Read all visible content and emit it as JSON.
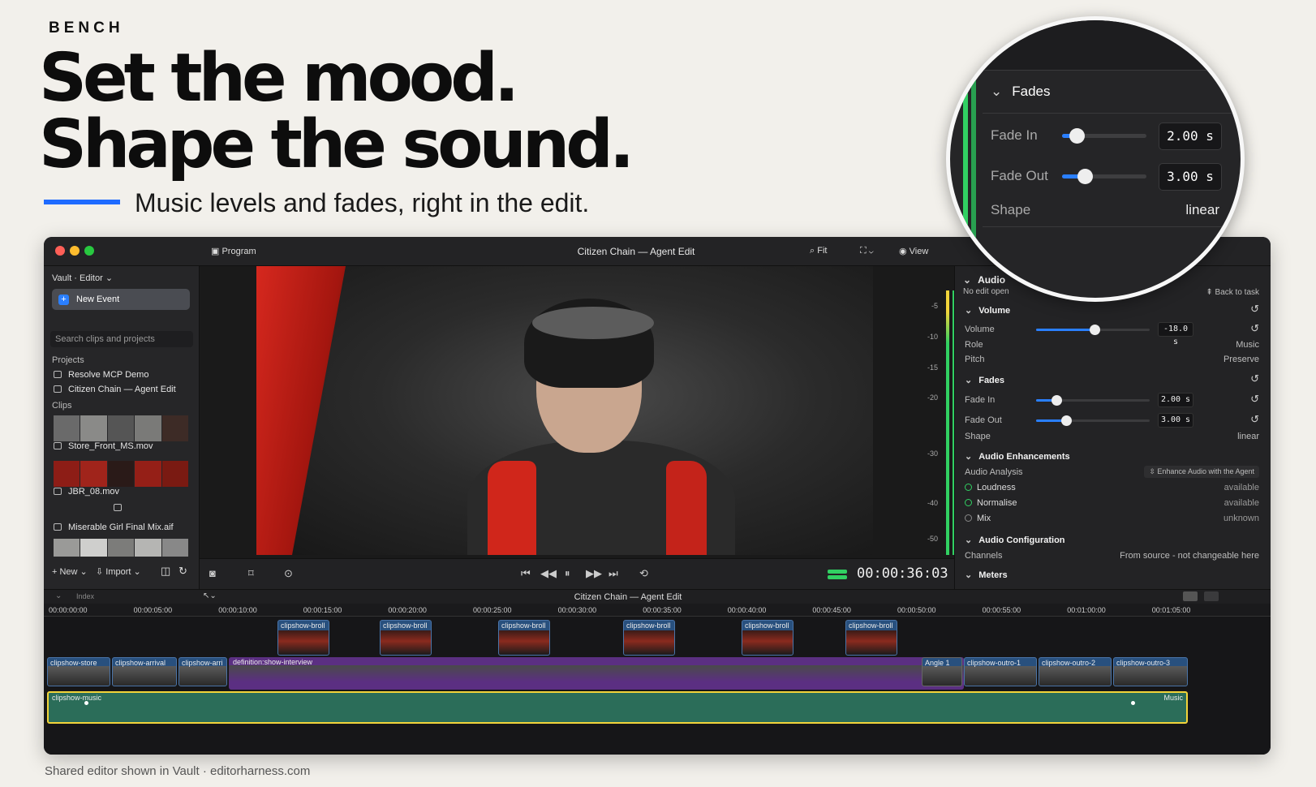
{
  "brand": "BENCH",
  "headline": {
    "line1": "Set the mood.",
    "line2": "Shape the sound."
  },
  "subhead": "Music levels and fades, right in the edit.",
  "footer": "Shared editor shown in Vault · editorharness.com",
  "colors": {
    "accent": "#1f6bff",
    "meter_green": "#31d062",
    "music_outline": "#f2d43a"
  },
  "window": {
    "program_label": "Program",
    "title": "Citizen Chain — Agent Edit",
    "fit_label": "Fit",
    "view_label": "View"
  },
  "sidebar": {
    "header": "Vault · Editor ⌄",
    "new_event": "New Event",
    "search_placeholder": "Search clips and projects",
    "projects_label": "Projects",
    "projects": [
      "Resolve MCP Demo",
      "Citizen Chain — Agent Edit"
    ],
    "clips_label": "Clips",
    "clips": [
      "Store_Front_MS.mov",
      "JBR_08.mov",
      "Miserable Girl Final Mix.aif"
    ],
    "new_label": "+ New ⌄",
    "import_label": "Import ⌄"
  },
  "meter_scale": [
    "-5",
    "-10",
    "-15",
    "-20",
    "-30",
    "-40",
    "-50"
  ],
  "transport": {
    "timecode": "00:00:36:03"
  },
  "inspector": {
    "title": "Audio",
    "subtitle": "No edit open",
    "back": "Back to task",
    "volume_section": "Volume",
    "volume_label": "Volume",
    "volume_value": "-18.0 s",
    "volume_level": 0.52,
    "role_label": "Role",
    "role_value": "Music",
    "pitch_label": "Pitch",
    "pitch_value": "Preserve",
    "fades_section": "Fades",
    "fade_in_label": "Fade In",
    "fade_in_value": "2.00 s",
    "fade_in_level": 0.18,
    "fade_out_label": "Fade Out",
    "fade_out_value": "3.00 s",
    "fade_out_level": 0.27,
    "shape_label": "Shape",
    "shape_value": "linear",
    "enh_section": "Audio Enhancements",
    "analysis_label": "Audio Analysis",
    "enhance_button": "Enhance Audio with the Agent",
    "loudness_label": "Loudness",
    "loudness_value": "available",
    "normalise_label": "Normalise",
    "normalise_value": "available",
    "mix_label": "Mix",
    "mix_value": "unknown",
    "config_section": "Audio Configuration",
    "channels_label": "Channels",
    "channels_value": "From source - not changeable here",
    "meters_section": "Meters"
  },
  "timeline": {
    "index_label": "Index",
    "title": "Citizen Chain — Agent Edit",
    "ruler": [
      "00:00:00:00",
      "00:00:05:00",
      "00:00:10:00",
      "00:00:15:00",
      "00:00:20:00",
      "00:00:25:00",
      "00:00:30:00",
      "00:00:35:00",
      "00:00:40:00",
      "00:00:45:00",
      "00:00:50:00",
      "00:00:55:00",
      "00:01:00:00",
      "00:01:05:00"
    ],
    "broll_label": "clipshow-broll",
    "main_clips": [
      "clipshow-store",
      "clipshow-arrival",
      "clipshow-arri",
      "definition:show-interview",
      "Angle 1",
      "clipshow-outro-1",
      "clipshow-outro-2",
      "clipshow-outro-3"
    ],
    "music_label": "clipshow-music",
    "music_role": "Music"
  },
  "magnifier": {
    "section": "Fades",
    "fade_in_label": "Fade In",
    "fade_in_value": "2.00 s",
    "fade_out_label": "Fade Out",
    "fade_out_value": "3.00 s",
    "shape_label": "Shape",
    "shape_value": "linear"
  }
}
